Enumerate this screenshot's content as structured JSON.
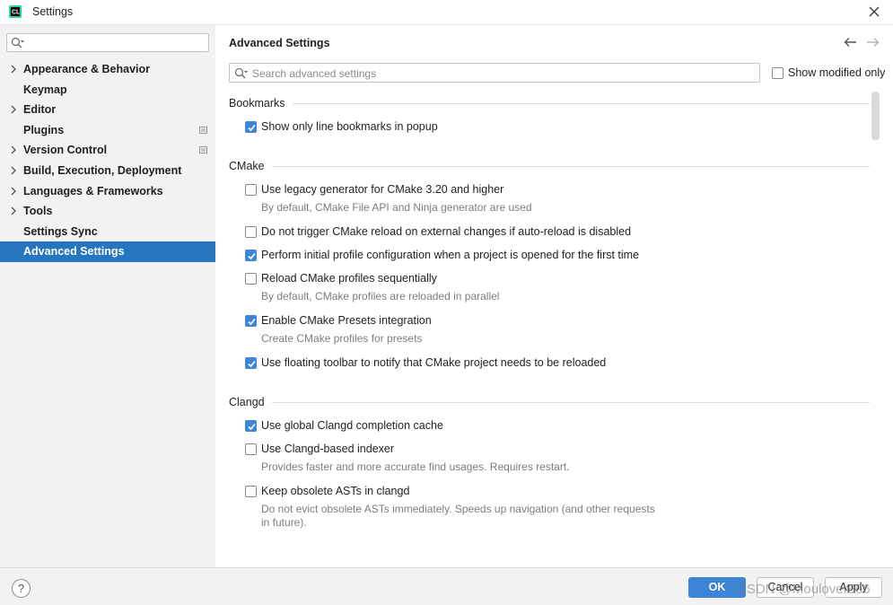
{
  "window": {
    "title": "Settings",
    "icon": "clion-app-icon",
    "close_icon": "close-icon"
  },
  "sidebar": {
    "search_placeholder": "",
    "items": [
      {
        "label": "Appearance & Behavior",
        "expandable": true
      },
      {
        "label": "Keymap",
        "expandable": false
      },
      {
        "label": "Editor",
        "expandable": true
      },
      {
        "label": "Plugins",
        "expandable": false,
        "badge": "settings-page-icon"
      },
      {
        "label": "Version Control",
        "expandable": true,
        "badge": "settings-page-icon"
      },
      {
        "label": "Build, Execution, Deployment",
        "expandable": true
      },
      {
        "label": "Languages & Frameworks",
        "expandable": true
      },
      {
        "label": "Tools",
        "expandable": true
      },
      {
        "label": "Settings Sync",
        "expandable": false
      },
      {
        "label": "Advanced Settings",
        "expandable": false,
        "selected": true
      }
    ],
    "selected_color": "#2675bf"
  },
  "main": {
    "title": "Advanced Settings",
    "search_placeholder": "Search advanced settings",
    "show_modified_label": "Show modified only",
    "show_modified_checked": false,
    "sections": [
      {
        "title": "Bookmarks",
        "options": [
          {
            "label": "Show only line bookmarks in popup",
            "checked": true,
            "hint": ""
          }
        ]
      },
      {
        "title": "CMake",
        "options": [
          {
            "label": "Use legacy generator for CMake 3.20 and higher",
            "checked": false,
            "hint": "By default, CMake File API and Ninja generator are used"
          },
          {
            "label": "Do not trigger CMake reload on external changes if auto-reload is disabled",
            "checked": false,
            "hint": ""
          },
          {
            "label": "Perform initial profile configuration when a project is opened for the first time",
            "checked": true,
            "hint": ""
          },
          {
            "label": "Reload CMake profiles sequentially",
            "checked": false,
            "hint": "By default, CMake profiles are reloaded in parallel"
          },
          {
            "label": "Enable CMake Presets integration",
            "checked": true,
            "hint": "Create CMake profiles for presets"
          },
          {
            "label": "Use floating toolbar to notify that CMake project needs to be reloaded",
            "checked": true,
            "hint": ""
          }
        ]
      },
      {
        "title": "Clangd",
        "options": [
          {
            "label": "Use global Clangd completion cache",
            "checked": true,
            "hint": ""
          },
          {
            "label": "Use Clangd-based indexer",
            "checked": false,
            "hint": "Provides faster and more accurate find usages. Requires restart."
          },
          {
            "label": "Keep obsolete ASTs in clangd",
            "checked": false,
            "hint": "Do not evict obsolete ASTs immediately. Speeds up navigation (and other requests",
            "hint2": "in future)."
          }
        ]
      }
    ],
    "accent_color": "#3e86d8"
  },
  "footer": {
    "help_label": "?",
    "ok_label": "OK",
    "cancel_label": "Cancel",
    "apply_label": "Apply",
    "watermark": "CSDN @Moulover666"
  }
}
